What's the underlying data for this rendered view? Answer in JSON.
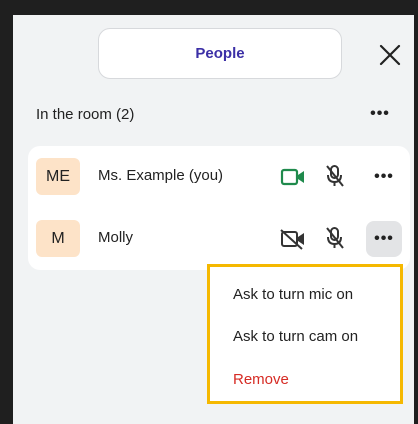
{
  "header": {
    "tab_label": "People",
    "close_icon": "close-icon"
  },
  "section": {
    "title": "In the room (2)",
    "more_glyph": "•••"
  },
  "participants": [
    {
      "initials": "ME",
      "name": "Ms. Example (you)",
      "camera_state": "on",
      "mic_state": "muted",
      "more_glyph": "•••"
    },
    {
      "initials": "M",
      "name": "Molly",
      "camera_state": "off",
      "mic_state": "muted",
      "more_glyph": "•••"
    }
  ],
  "menu": {
    "items": [
      {
        "label": "Ask to turn mic on"
      },
      {
        "label": "Ask to turn cam on"
      },
      {
        "label": "Remove"
      }
    ]
  },
  "colors": {
    "accent_text": "#3b2fa6",
    "camera_on": "#1f8a4c",
    "danger": "#d62b24",
    "highlight_border": "#f5b800",
    "avatar_bg": "#fde3c8"
  }
}
